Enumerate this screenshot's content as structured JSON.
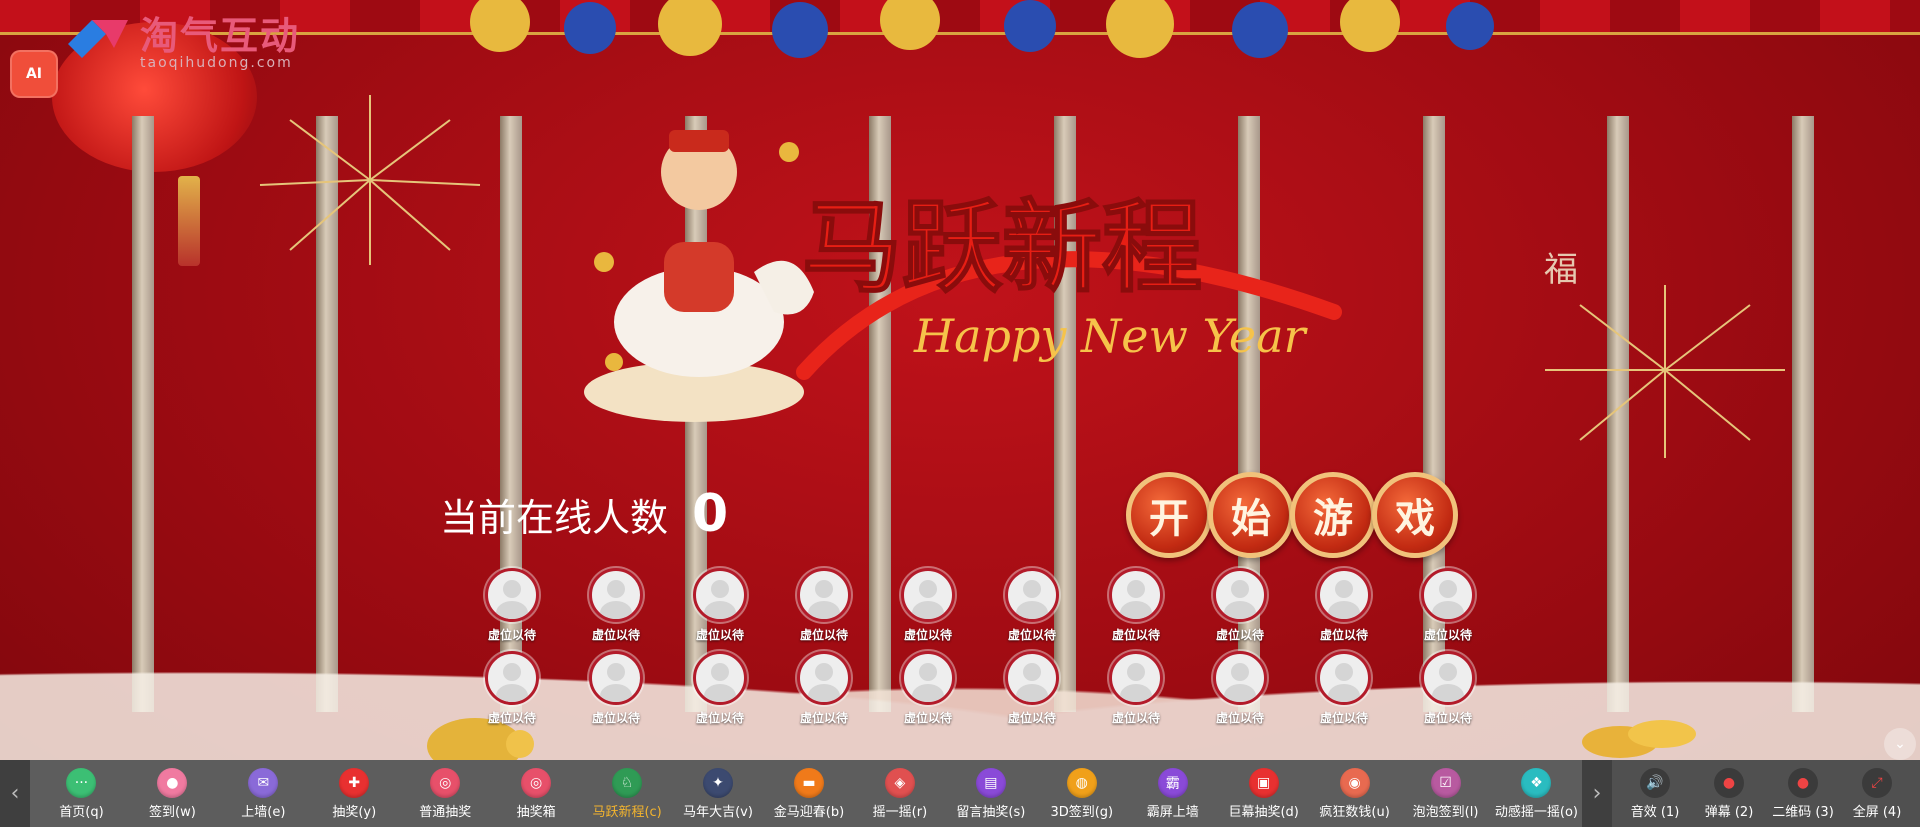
{
  "logo": {
    "name": "淘气互动",
    "sub": "taoqihudong.com"
  },
  "ai_button": "AI",
  "decor": {
    "fu": "福"
  },
  "banner": {
    "title": "马跃新程",
    "subtitle": "Happy New Year"
  },
  "online": {
    "label": "当前在线人数",
    "count": "0"
  },
  "start_button": [
    "开",
    "始",
    "游",
    "戏"
  ],
  "slots": [
    "虚位以待",
    "虚位以待",
    "虚位以待",
    "虚位以待",
    "虚位以待",
    "虚位以待",
    "虚位以待",
    "虚位以待",
    "虚位以待",
    "虚位以待",
    "虚位以待",
    "虚位以待",
    "虚位以待",
    "虚位以待",
    "虚位以待",
    "虚位以待",
    "虚位以待",
    "虚位以待",
    "虚位以待",
    "虚位以待"
  ],
  "toolbar": {
    "prev_arrow": "‹",
    "next_arrow": "›",
    "items": [
      {
        "label": "首页(q)",
        "icon": "chat-icon",
        "color": "#3cbf74",
        "glyph": "···",
        "active": false
      },
      {
        "label": "签到(w)",
        "icon": "user-icon",
        "color": "#f07aa0",
        "glyph": "●",
        "active": false
      },
      {
        "label": "上墙(e)",
        "icon": "message-icon",
        "color": "#8a6ad8",
        "glyph": "✉",
        "active": false
      },
      {
        "label": "抽奖(y)",
        "icon": "gift-icon",
        "color": "#e83030",
        "glyph": "✚",
        "active": false
      },
      {
        "label": "普通抽奖",
        "icon": "lottery-icon",
        "color": "#e7506a",
        "glyph": "◎",
        "active": false
      },
      {
        "label": "抽奖箱",
        "icon": "box-icon",
        "color": "#e7506a",
        "glyph": "◎",
        "active": false
      },
      {
        "label": "马跃新程(c)",
        "icon": "horse-icon",
        "color": "#2f9b55",
        "glyph": "♘",
        "active": true
      },
      {
        "label": "马年大吉(v)",
        "icon": "wand-icon",
        "color": "#3c4a70",
        "glyph": "✦",
        "active": false
      },
      {
        "label": "金马迎春(b)",
        "icon": "car-icon",
        "color": "#f07a1a",
        "glyph": "▬",
        "active": false
      },
      {
        "label": "摇一摇(r)",
        "icon": "shake-icon",
        "color": "#e05050",
        "glyph": "◈",
        "active": false
      },
      {
        "label": "留言抽奖(s)",
        "icon": "note-icon",
        "color": "#8a4ad8",
        "glyph": "▤",
        "active": false
      },
      {
        "label": "3D签到(g)",
        "icon": "globe-icon",
        "color": "#f0a01a",
        "glyph": "◍",
        "active": false
      },
      {
        "label": "霸屏上墙",
        "icon": "badge-icon",
        "color": "#8a4ad8",
        "glyph": "霸",
        "active": false
      },
      {
        "label": "巨幕抽奖(d)",
        "icon": "screen-icon",
        "color": "#e83030",
        "glyph": "▣",
        "active": false
      },
      {
        "label": "疯狂数钱(u)",
        "icon": "money-icon",
        "color": "#e86a50",
        "glyph": "◉",
        "active": false
      },
      {
        "label": "泡泡签到(l)",
        "icon": "bubble-icon",
        "color": "#b85aa0",
        "glyph": "☑",
        "active": false
      },
      {
        "label": "动感摇一摇(o)",
        "icon": "dynamic-shake-icon",
        "color": "#2abcc0",
        "glyph": "❖",
        "active": false
      }
    ],
    "settings": [
      {
        "label": "音效 (1)",
        "icon": "sound-icon",
        "glyph": "🔊"
      },
      {
        "label": "弹幕 (2)",
        "icon": "danmaku-icon",
        "glyph": "●"
      },
      {
        "label": "二维码 (3)",
        "icon": "qrcode-icon",
        "glyph": "●"
      },
      {
        "label": "全屏 (4)",
        "icon": "fullscreen-icon",
        "glyph": "⤢"
      }
    ]
  },
  "corner_toggle": "⌄"
}
